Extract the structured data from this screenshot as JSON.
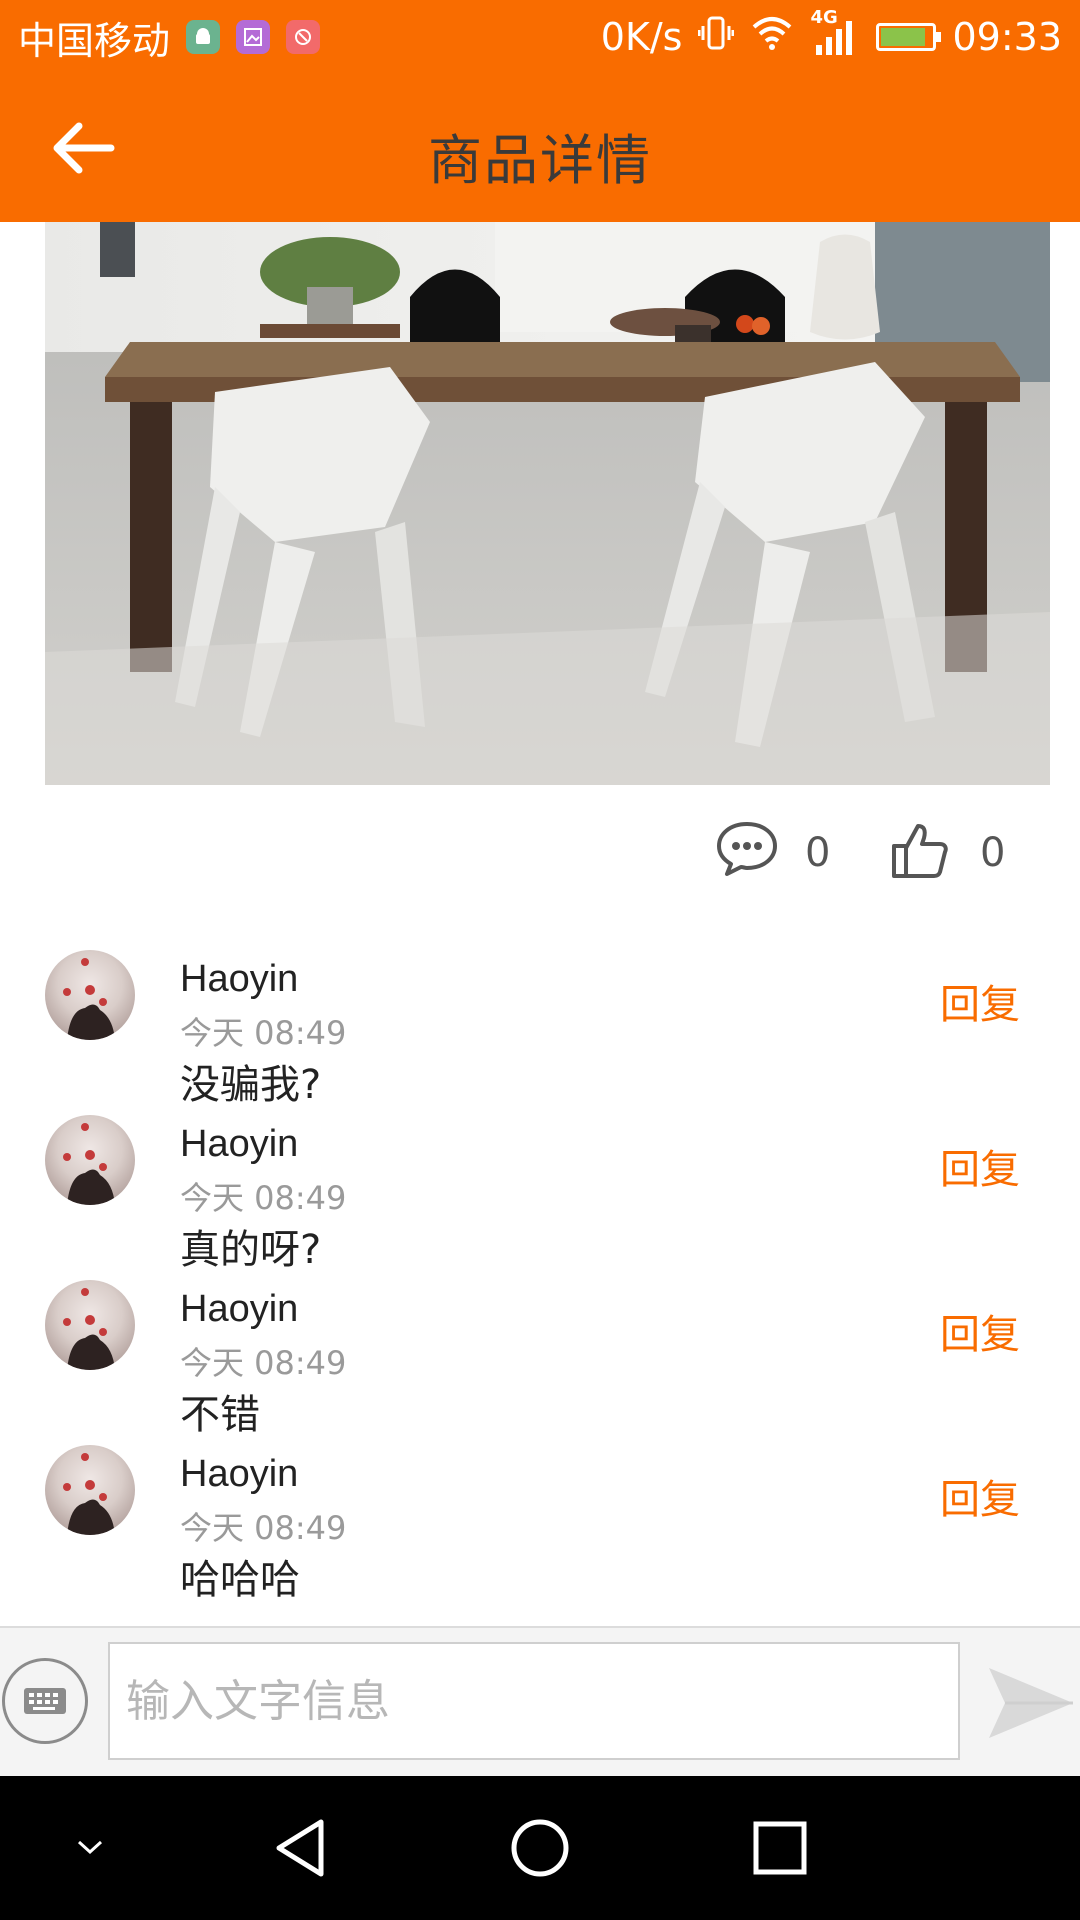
{
  "status_bar": {
    "carrier": "中国移动",
    "net_speed": "0K/s",
    "network_type": "4G",
    "time": "09:33",
    "icons": [
      "android-icon",
      "gallery-icon",
      "app-icon",
      "vibrate-icon",
      "wifi-icon",
      "signal-icon",
      "battery-charging-icon"
    ]
  },
  "header": {
    "title": "商品详情",
    "back_icon": "arrow-left-icon"
  },
  "product": {
    "image_icon": "product-photo"
  },
  "stats": {
    "comment_count": "0",
    "like_count": "0",
    "comment_icon": "comment-bubble-icon",
    "like_icon": "thumbs-up-icon"
  },
  "comments": [
    {
      "name": "Haoyin",
      "time": "今天 08:49",
      "text": "没骗我?",
      "reply_label": "回复"
    },
    {
      "name": "Haoyin",
      "time": "今天 08:49",
      "text": "真的呀?",
      "reply_label": "回复"
    },
    {
      "name": "Haoyin",
      "time": "今天 08:49",
      "text": "不错",
      "reply_label": "回复"
    },
    {
      "name": "Haoyin",
      "time": "今天 08:49",
      "text": "哈哈哈",
      "reply_label": "回复"
    }
  ],
  "input_bar": {
    "placeholder": "输入文字信息",
    "keyboard_icon": "keyboard-icon",
    "send_icon": "send-icon"
  },
  "colors": {
    "accent": "#f96c00",
    "title_text": "#3a3a3a",
    "reply": "#f96c00",
    "muted": "#9a9a9a",
    "nav_bg": "#000000"
  }
}
